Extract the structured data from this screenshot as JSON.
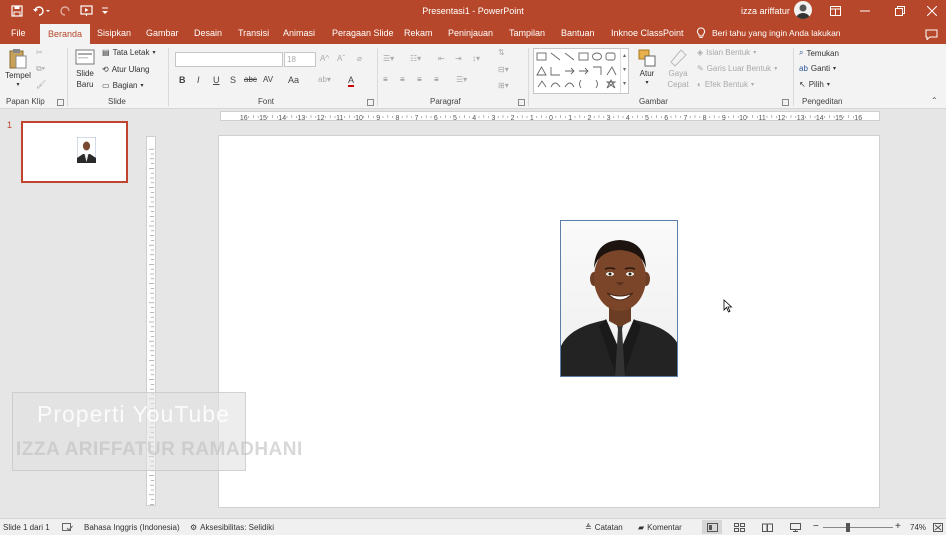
{
  "titlebar": {
    "app_title": "Presentasi1 - PowerPoint",
    "user_name": "izza ariffatur",
    "accent_color": "#b7472a"
  },
  "tabs": [
    "File",
    "Beranda",
    "Sisipkan",
    "Gambar",
    "Desain",
    "Transisi",
    "Animasi",
    "Peragaan Slide",
    "Rekam",
    "Peninjauan",
    "Tampilan",
    "Bantuan",
    "Inknoe ClassPoint"
  ],
  "active_tab": "Beranda",
  "tell_me": "Beri tahu yang ingin Anda lakukan",
  "ribbon": {
    "clipboard": {
      "paste": "Tempel",
      "label": "Papan Klip"
    },
    "slides": {
      "new_slide_1": "Slide",
      "new_slide_2": "Baru",
      "layout": "Tata Letak",
      "reset": "Atur Ulang",
      "section": "Bagian",
      "label": "Slide"
    },
    "font": {
      "size": "18",
      "bold": "B",
      "italic": "I",
      "underline": "U",
      "shadow": "S",
      "strike": "abc",
      "spacing": "AV",
      "case": "Aa",
      "color": "A",
      "label": "Font"
    },
    "paragraph": {
      "label": "Paragraf"
    },
    "drawing": {
      "arrange": "Atur",
      "quick_styles_1": "Gaya",
      "quick_styles_2": "Cepat",
      "fill": "Isian Bentuk",
      "outline": "Garis Luar Bentuk",
      "effects": "Efek Bentuk",
      "label": "Gambar"
    },
    "editing": {
      "find": "Temukan",
      "replace": "Ganti",
      "select": "Pilih",
      "label": "Pengeditan"
    }
  },
  "slide_panel": {
    "number": "1"
  },
  "watermark": {
    "line1": "Properti YouTube",
    "line2": "IZZA ARIFFATUR RAMADHANI"
  },
  "statusbar": {
    "slide_info": "Slide 1 dari 1",
    "language": "Bahasa Inggris (Indonesia)",
    "accessibility": "Aksesibilitas: Selidiki",
    "notes": "Catatan",
    "comments": "Komentar",
    "zoom": "74%"
  }
}
